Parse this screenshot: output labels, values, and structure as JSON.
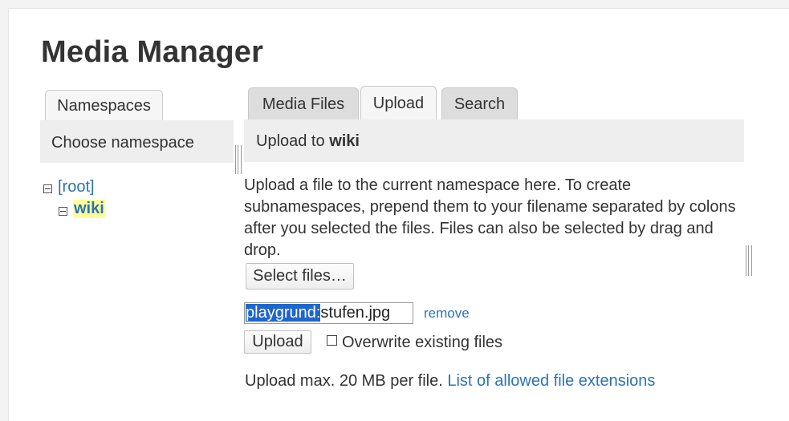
{
  "page_title": "Media Manager",
  "namespaces": {
    "tab_label": "Namespaces",
    "header": "Choose namespace",
    "tree": [
      {
        "label": "[root]",
        "toggle": "−"
      },
      {
        "label": "wiki",
        "toggle": "−",
        "current": true
      }
    ]
  },
  "tabs": [
    {
      "label": "Media Files",
      "active": false
    },
    {
      "label": "Upload",
      "active": true
    },
    {
      "label": "Search",
      "active": false
    }
  ],
  "upload": {
    "header_prefix": "Upload to",
    "header_namespace": "wiki",
    "description": "Upload a file to the current namespace here. To create subnamespaces, prepend them to your filename separated by colons after you selected the files. Files can also be selected by drag and drop.",
    "select_button": "Select files…",
    "filename_selected": "playgrund:",
    "filename_rest": "stufen.jpg",
    "remove_link": "remove",
    "upload_button": "Upload",
    "overwrite_label": "Overwrite existing files",
    "overwrite_checked": false,
    "max_info": "Upload max. 20 MB per file.",
    "extensions_link": "List of allowed file extensions"
  },
  "colors": {
    "link": "#2b73b7",
    "highlight": "#ffff99",
    "selection": "#1f66cc",
    "header_bg": "#eeeeee"
  }
}
